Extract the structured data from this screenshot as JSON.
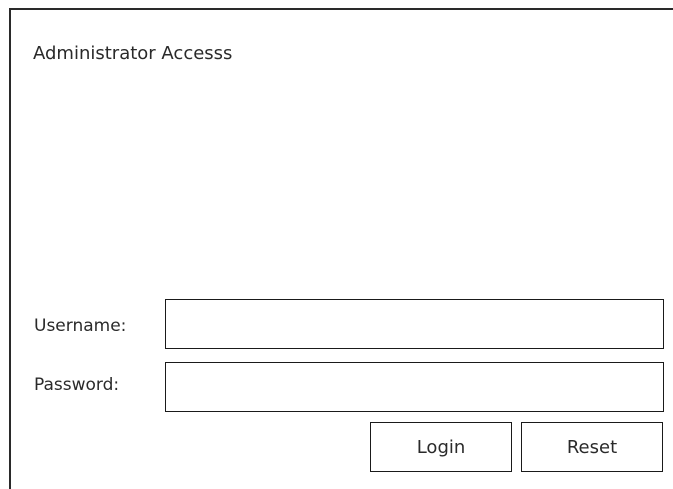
{
  "dialog": {
    "title": "Administrator Accesss"
  },
  "form": {
    "username_label": "Username:",
    "username_value": "",
    "password_label": "Password:",
    "password_value": "",
    "login_label": "Login",
    "reset_label": "Reset"
  }
}
